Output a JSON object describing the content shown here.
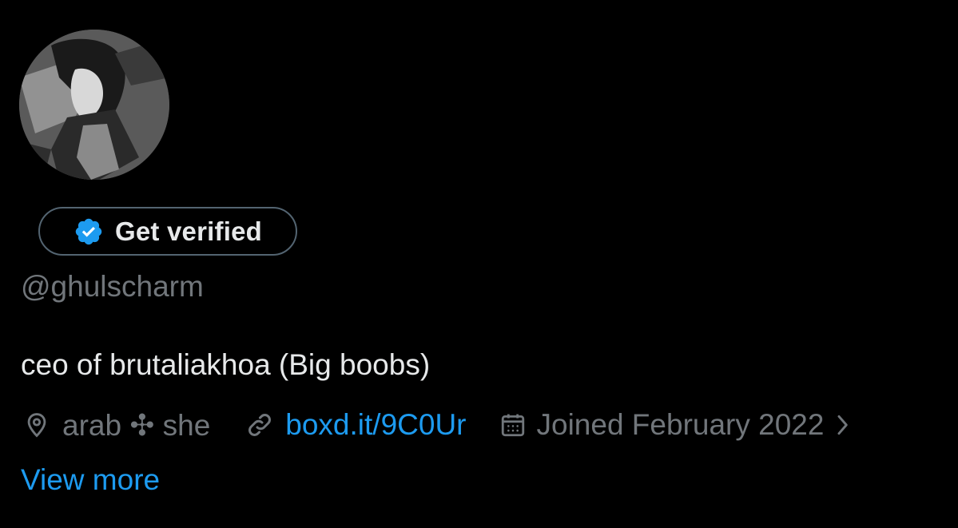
{
  "profile": {
    "avatar_icon": "profile-avatar",
    "handle": "@ghulscharm",
    "bio": "ceo of brutaliakhoa (Big boobs)",
    "location": "arab ✣ she",
    "website": "boxd.it/9C0Ur",
    "joined": "Joined February 2022",
    "view_more": "View more"
  },
  "verify": {
    "label": "Get verified",
    "badge_icon": "verified-badge-icon"
  },
  "icons": {
    "location": "location-pin-icon",
    "link": "link-icon",
    "calendar": "calendar-icon",
    "chevron": "chevron-right-icon"
  },
  "colors": {
    "background": "#000000",
    "text": "#e7e9ea",
    "secondary": "#71767b",
    "accent": "#1d9bf0",
    "border": "#536471"
  }
}
